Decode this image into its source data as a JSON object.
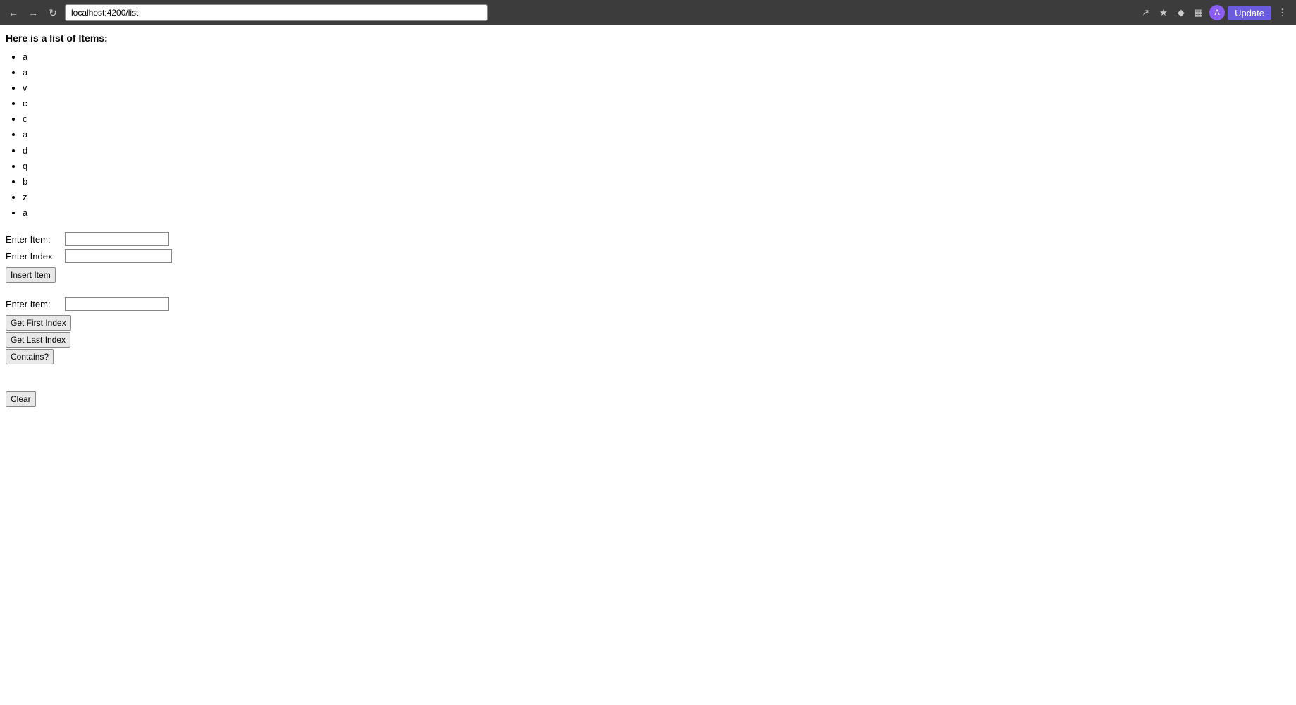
{
  "browser": {
    "url": "localhost:4200/list",
    "update_label": "Update",
    "avatar_label": "A"
  },
  "page": {
    "title": "Here is a list of Items:",
    "items": [
      "a",
      "a",
      "v",
      "c",
      "c",
      "a",
      "d",
      "q",
      "b",
      "z",
      "a"
    ]
  },
  "insert_form": {
    "item_label": "Enter Item:",
    "index_label": "Enter Index:",
    "button_label": "Insert Item",
    "item_placeholder": "",
    "index_placeholder": ""
  },
  "search_form": {
    "item_label": "Enter Item:",
    "get_first_label": "Get First Index",
    "get_last_label": "Get Last Index",
    "contains_label": "Contains?",
    "item_placeholder": ""
  },
  "clear_button": {
    "label": "Clear"
  }
}
